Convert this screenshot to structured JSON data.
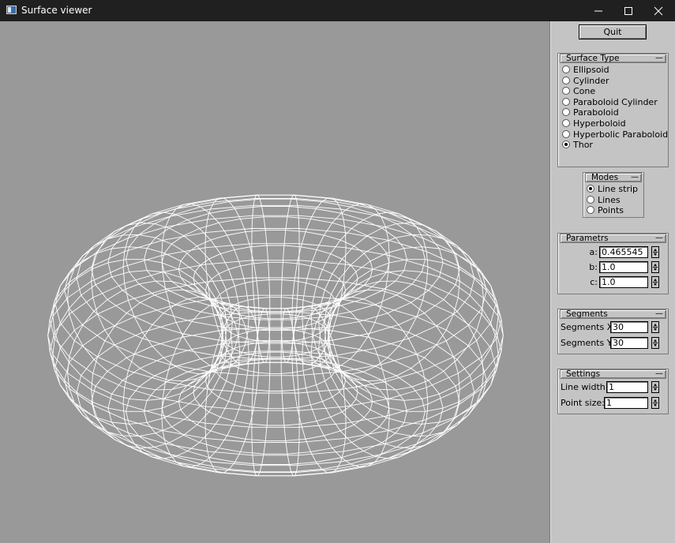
{
  "window": {
    "title": "Surface viewer"
  },
  "titlebar": {
    "minimize": "–",
    "maximize": "☐",
    "close": "✕"
  },
  "panel": {
    "quit_label": "Quit",
    "surface_type": {
      "title": "Surface Type",
      "options": [
        "Ellipsoid",
        "Cylinder",
        "Cone",
        "Paraboloid Cylinder",
        "Paraboloid",
        "Hyperboloid",
        "Hyperbolic Paraboloid",
        "Thor"
      ],
      "selected": "Thor"
    },
    "modes": {
      "title": "Modes",
      "options": [
        "Line strip",
        "Lines",
        "Points"
      ],
      "selected": "Line strip"
    },
    "parameters": {
      "title": "Parametrs",
      "a_label": "a:",
      "a_value": "0.465545",
      "b_label": "b:",
      "b_value": "1.0",
      "c_label": "c:",
      "c_value": "1.0"
    },
    "segments": {
      "title": "Segments",
      "x_label": "Segments X:",
      "x_value": "30",
      "y_label": "Segments Y:",
      "y_value": "30"
    },
    "settings": {
      "title": "Settings",
      "line_width_label": "Line width:",
      "line_width_value": "1",
      "point_size_label": "Point size:",
      "point_size_value": "1"
    }
  },
  "colors": {
    "titlebar": "#202020",
    "viewport": "#999999",
    "panel": "#c4c4c4",
    "wire": "#ffffff"
  }
}
